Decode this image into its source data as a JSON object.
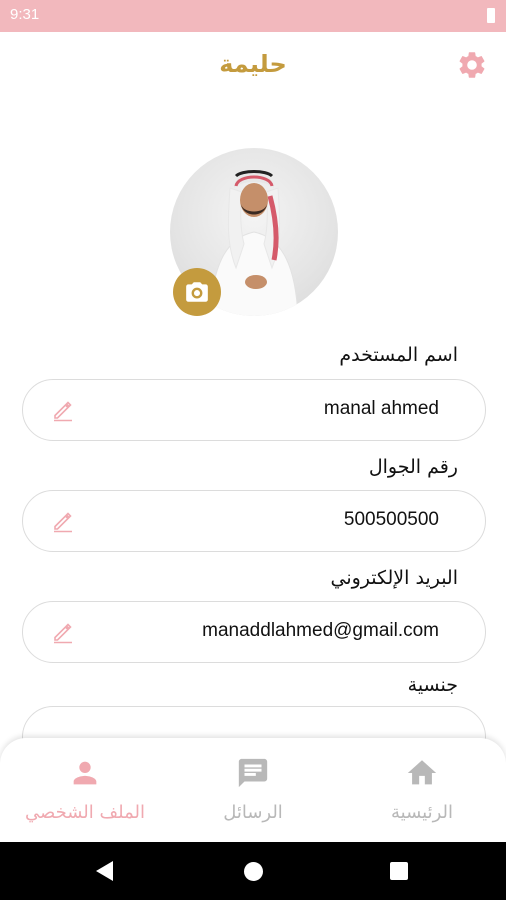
{
  "status_bar": {
    "time": "9:31"
  },
  "header": {
    "title": "حليمة",
    "settings_icon": "gear-icon"
  },
  "colors": {
    "accent": "#c49b3e",
    "pink": "#f2b8bd",
    "pink_icon": "#f0a9b0",
    "nav_inactive": "#b8b8b8"
  },
  "profile": {
    "fields": [
      {
        "label": "اسم المستخدم",
        "value": "manal ahmed"
      },
      {
        "label": "رقم الجوال",
        "value": "500500500"
      },
      {
        "label": "البريد الإلكتروني",
        "value": "manaddlahmed@gmail.com"
      },
      {
        "label": "جنسية",
        "value": ""
      }
    ]
  },
  "bottom_nav": [
    {
      "label": "الملف الشخصي",
      "icon": "person-icon",
      "active": true
    },
    {
      "label": "الرسائل",
      "icon": "chat-icon",
      "active": false
    },
    {
      "label": "الرئيسية",
      "icon": "home-icon",
      "active": false
    }
  ]
}
